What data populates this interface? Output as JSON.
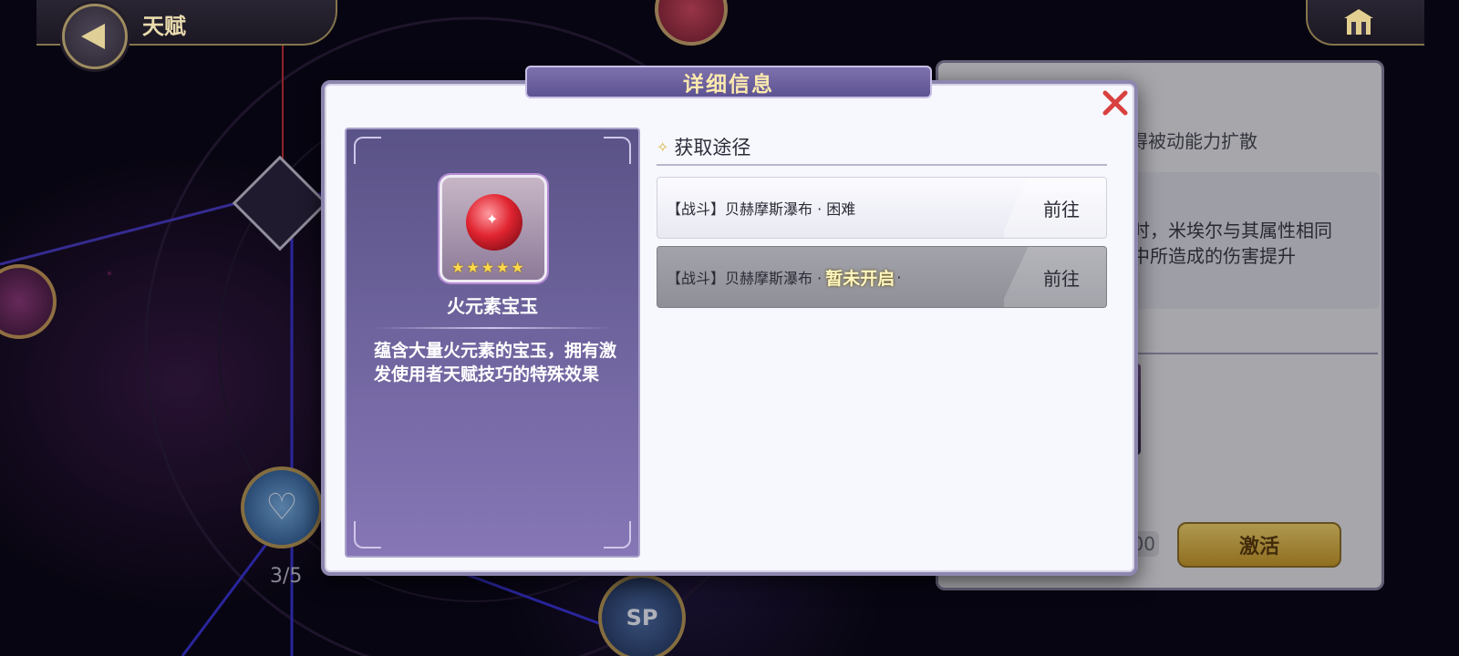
{
  "header": {
    "title": "天赋",
    "back_icon": "back-arrow-icon",
    "home_icon": "home-icon"
  },
  "background": {
    "node_progress": "3/5",
    "sp_label": "SP"
  },
  "right_panel": {
    "line1": "得被动能力扩散",
    "line2": "时，米埃尔与其属性相同",
    "line3": "中所造成的伤害提升",
    "count_text": "00",
    "activate_label": "激活"
  },
  "modal": {
    "title": "详细信息",
    "item": {
      "name": "火元素宝玉",
      "rarity_stars": 5,
      "description": "蕴含大量火元素的宝玉，拥有激发使用者天赋技巧的特殊效果"
    },
    "acquisition": {
      "header": "获取途径",
      "routes": [
        {
          "text": "【战斗】贝赫摩斯瀑布 · 困难",
          "locked_text": "",
          "go_label": "前往"
        },
        {
          "text": "【战斗】贝赫摩斯瀑布 · ",
          "locked_text": "暂未开启",
          "suffix": " ·",
          "go_label": "前往"
        }
      ]
    }
  },
  "colors": {
    "modal_title_bg": "#6a5f9f",
    "modal_title_text": "#fbe9ad",
    "item_card_top": "#5a5387",
    "item_card_bottom": "#8676b6",
    "close_x": "#d8413f",
    "activate_button": "#e0b84c"
  }
}
